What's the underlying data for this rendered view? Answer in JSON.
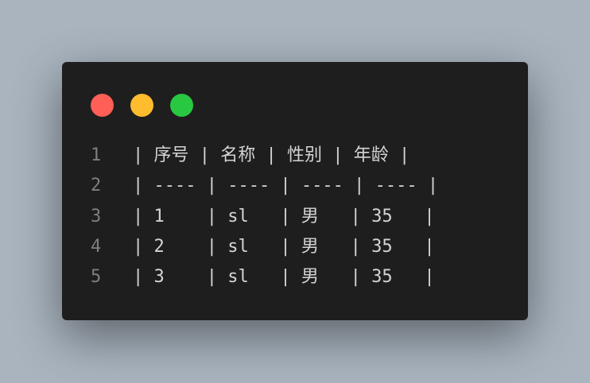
{
  "window_controls": {
    "close_color": "#ff5f57",
    "minimize_color": "#febc2e",
    "maximize_color": "#28c840"
  },
  "code": {
    "lines": [
      {
        "number": "1",
        "text": "| 序号 | 名称 | 性别 | 年龄 |"
      },
      {
        "number": "2",
        "text": "| ---- | ---- | ---- | ---- |"
      },
      {
        "number": "3",
        "text": "| 1    | sl   | 男   | 35   |"
      },
      {
        "number": "4",
        "text": "| 2    | sl   | 男   | 35   |"
      },
      {
        "number": "5",
        "text": "| 3    | sl   | 男   | 35   |"
      }
    ]
  }
}
